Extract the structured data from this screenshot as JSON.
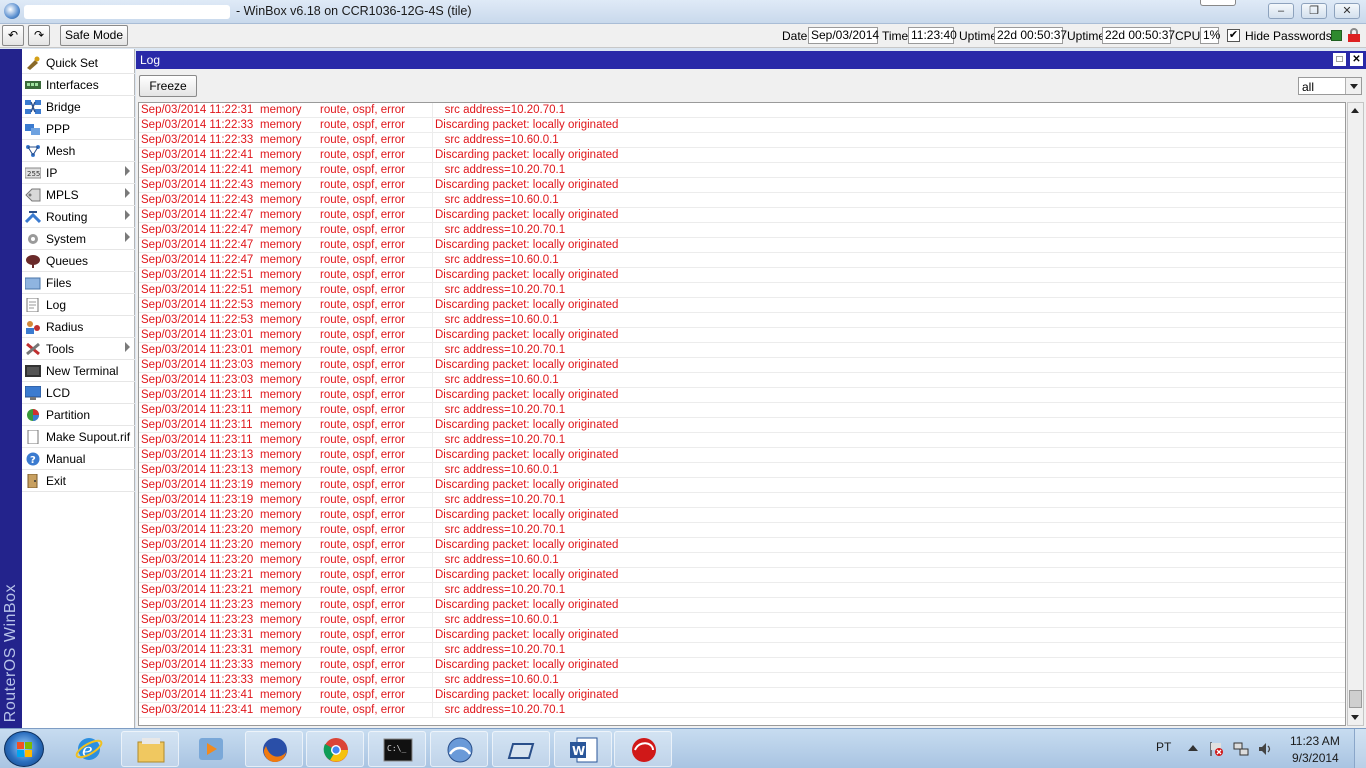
{
  "window": {
    "title": "- WinBox v6.18 on CCR1036-12G-4S (tile)",
    "controls": [
      "minimize",
      "restore",
      "close"
    ]
  },
  "toolbar": {
    "undo_icon": "undo-icon",
    "redo_icon": "redo-icon",
    "safe_mode_label": "Safe Mode",
    "date_label": "Date:",
    "date_value": "Sep/03/2014",
    "time_label": "Time:",
    "time_value": "11:23:40",
    "uptime1_label": "Uptime:",
    "uptime1_value": "22d 00:50:37",
    "uptime2_label": "Uptime:",
    "uptime2_value": "22d 00:50:37",
    "cpu_label": "CPU:",
    "cpu_value": "1%",
    "hide_passwords_label": "Hide Passwords",
    "hide_passwords_checked": "✔"
  },
  "brand": "RouterOS WinBox",
  "sidebar": {
    "items": [
      {
        "label": "Quick Set",
        "icon": "quick-set-icon",
        "submenu": false
      },
      {
        "label": "Interfaces",
        "icon": "interfaces-icon",
        "submenu": false
      },
      {
        "label": "Bridge",
        "icon": "bridge-icon",
        "submenu": false
      },
      {
        "label": "PPP",
        "icon": "ppp-icon",
        "submenu": false
      },
      {
        "label": "Mesh",
        "icon": "mesh-icon",
        "submenu": false
      },
      {
        "label": "IP",
        "icon": "ip-icon",
        "submenu": true
      },
      {
        "label": "MPLS",
        "icon": "mpls-icon",
        "submenu": true
      },
      {
        "label": "Routing",
        "icon": "routing-icon",
        "submenu": true
      },
      {
        "label": "System",
        "icon": "system-gear-icon",
        "submenu": true
      },
      {
        "label": "Queues",
        "icon": "queues-icon",
        "submenu": false
      },
      {
        "label": "Files",
        "icon": "folder-icon",
        "submenu": false
      },
      {
        "label": "Log",
        "icon": "log-icon",
        "submenu": false
      },
      {
        "label": "Radius",
        "icon": "radius-icon",
        "submenu": false
      },
      {
        "label": "Tools",
        "icon": "tools-icon",
        "submenu": true
      },
      {
        "label": "New Terminal",
        "icon": "terminal-icon",
        "submenu": false
      },
      {
        "label": "LCD",
        "icon": "lcd-icon",
        "submenu": false
      },
      {
        "label": "Partition",
        "icon": "partition-icon",
        "submenu": false
      },
      {
        "label": "Make Supout.rif",
        "icon": "document-icon",
        "submenu": false
      },
      {
        "label": "Manual",
        "icon": "help-icon",
        "submenu": false
      },
      {
        "label": "Exit",
        "icon": "exit-icon",
        "submenu": false
      }
    ]
  },
  "log": {
    "title": "Log",
    "freeze_label": "Freeze",
    "filter_value": "all",
    "text_color": "#e0161b",
    "rows": [
      [
        "Sep/03/2014 11:22:31",
        "memory",
        "route, ospf, error",
        "   src address=10.20.70.1"
      ],
      [
        "Sep/03/2014 11:22:33",
        "memory",
        "route, ospf, error",
        "Discarding packet: locally originated"
      ],
      [
        "Sep/03/2014 11:22:33",
        "memory",
        "route, ospf, error",
        "   src address=10.60.0.1"
      ],
      [
        "Sep/03/2014 11:22:41",
        "memory",
        "route, ospf, error",
        "Discarding packet: locally originated"
      ],
      [
        "Sep/03/2014 11:22:41",
        "memory",
        "route, ospf, error",
        "   src address=10.20.70.1"
      ],
      [
        "Sep/03/2014 11:22:43",
        "memory",
        "route, ospf, error",
        "Discarding packet: locally originated"
      ],
      [
        "Sep/03/2014 11:22:43",
        "memory",
        "route, ospf, error",
        "   src address=10.60.0.1"
      ],
      [
        "Sep/03/2014 11:22:47",
        "memory",
        "route, ospf, error",
        "Discarding packet: locally originated"
      ],
      [
        "Sep/03/2014 11:22:47",
        "memory",
        "route, ospf, error",
        "   src address=10.20.70.1"
      ],
      [
        "Sep/03/2014 11:22:47",
        "memory",
        "route, ospf, error",
        "Discarding packet: locally originated"
      ],
      [
        "Sep/03/2014 11:22:47",
        "memory",
        "route, ospf, error",
        "   src address=10.60.0.1"
      ],
      [
        "Sep/03/2014 11:22:51",
        "memory",
        "route, ospf, error",
        "Discarding packet: locally originated"
      ],
      [
        "Sep/03/2014 11:22:51",
        "memory",
        "route, ospf, error",
        "   src address=10.20.70.1"
      ],
      [
        "Sep/03/2014 11:22:53",
        "memory",
        "route, ospf, error",
        "Discarding packet: locally originated"
      ],
      [
        "Sep/03/2014 11:22:53",
        "memory",
        "route, ospf, error",
        "   src address=10.60.0.1"
      ],
      [
        "Sep/03/2014 11:23:01",
        "memory",
        "route, ospf, error",
        "Discarding packet: locally originated"
      ],
      [
        "Sep/03/2014 11:23:01",
        "memory",
        "route, ospf, error",
        "   src address=10.20.70.1"
      ],
      [
        "Sep/03/2014 11:23:03",
        "memory",
        "route, ospf, error",
        "Discarding packet: locally originated"
      ],
      [
        "Sep/03/2014 11:23:03",
        "memory",
        "route, ospf, error",
        "   src address=10.60.0.1"
      ],
      [
        "Sep/03/2014 11:23:11",
        "memory",
        "route, ospf, error",
        "Discarding packet: locally originated"
      ],
      [
        "Sep/03/2014 11:23:11",
        "memory",
        "route, ospf, error",
        "   src address=10.20.70.1"
      ],
      [
        "Sep/03/2014 11:23:11",
        "memory",
        "route, ospf, error",
        "Discarding packet: locally originated"
      ],
      [
        "Sep/03/2014 11:23:11",
        "memory",
        "route, ospf, error",
        "   src address=10.20.70.1"
      ],
      [
        "Sep/03/2014 11:23:13",
        "memory",
        "route, ospf, error",
        "Discarding packet: locally originated"
      ],
      [
        "Sep/03/2014 11:23:13",
        "memory",
        "route, ospf, error",
        "   src address=10.60.0.1"
      ],
      [
        "Sep/03/2014 11:23:19",
        "memory",
        "route, ospf, error",
        "Discarding packet: locally originated"
      ],
      [
        "Sep/03/2014 11:23:19",
        "memory",
        "route, ospf, error",
        "   src address=10.20.70.1"
      ],
      [
        "Sep/03/2014 11:23:20",
        "memory",
        "route, ospf, error",
        "Discarding packet: locally originated"
      ],
      [
        "Sep/03/2014 11:23:20",
        "memory",
        "route, ospf, error",
        "   src address=10.20.70.1"
      ],
      [
        "Sep/03/2014 11:23:20",
        "memory",
        "route, ospf, error",
        "Discarding packet: locally originated"
      ],
      [
        "Sep/03/2014 11:23:20",
        "memory",
        "route, ospf, error",
        "   src address=10.60.0.1"
      ],
      [
        "Sep/03/2014 11:23:21",
        "memory",
        "route, ospf, error",
        "Discarding packet: locally originated"
      ],
      [
        "Sep/03/2014 11:23:21",
        "memory",
        "route, ospf, error",
        "   src address=10.20.70.1"
      ],
      [
        "Sep/03/2014 11:23:23",
        "memory",
        "route, ospf, error",
        "Discarding packet: locally originated"
      ],
      [
        "Sep/03/2014 11:23:23",
        "memory",
        "route, ospf, error",
        "   src address=10.60.0.1"
      ],
      [
        "Sep/03/2014 11:23:31",
        "memory",
        "route, ospf, error",
        "Discarding packet: locally originated"
      ],
      [
        "Sep/03/2014 11:23:31",
        "memory",
        "route, ospf, error",
        "   src address=10.20.70.1"
      ],
      [
        "Sep/03/2014 11:23:33",
        "memory",
        "route, ospf, error",
        "Discarding packet: locally originated"
      ],
      [
        "Sep/03/2014 11:23:33",
        "memory",
        "route, ospf, error",
        "   src address=10.60.0.1"
      ],
      [
        "Sep/03/2014 11:23:41",
        "memory",
        "route, ospf, error",
        "Discarding packet: locally originated"
      ],
      [
        "Sep/03/2014 11:23:41",
        "memory",
        "route, ospf, error",
        "   src address=10.20.70.1"
      ]
    ]
  },
  "taskbar": {
    "pinned": [
      "internet-explorer-icon",
      "file-explorer-icon",
      "media-player-icon",
      "firefox-icon",
      "chrome-icon",
      "command-prompt-icon",
      "winbox-icon",
      "network-drive-icon",
      "word-icon",
      "red-app-icon"
    ],
    "language": "PT",
    "clock_time": "11:23 AM",
    "clock_date": "9/3/2014"
  }
}
